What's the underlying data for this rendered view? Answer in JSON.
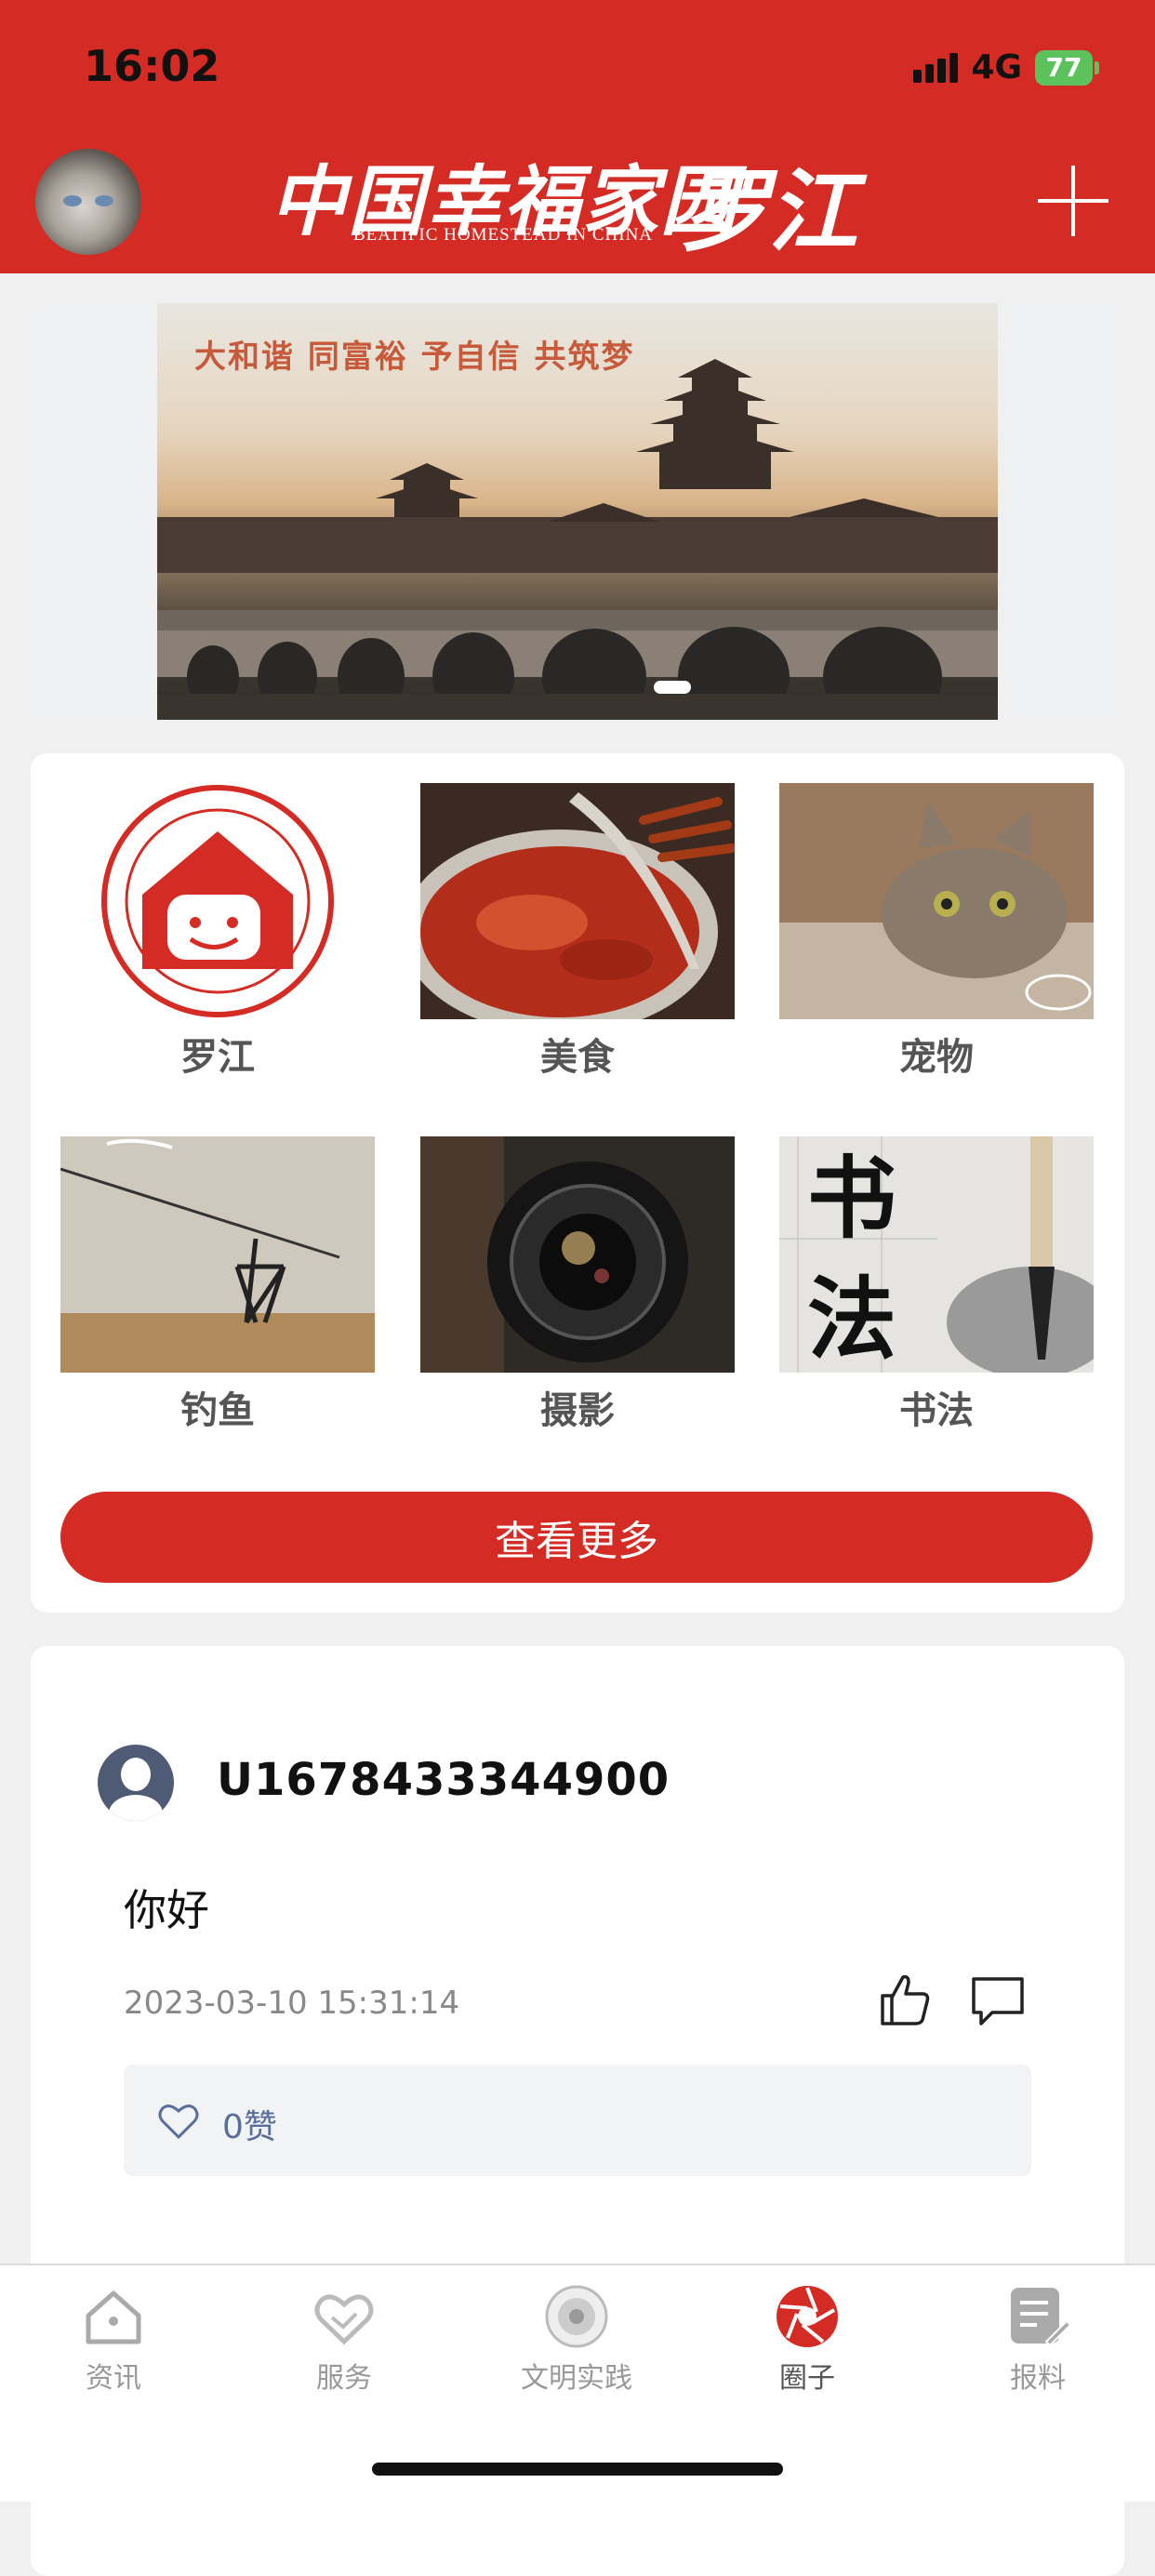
{
  "status_bar": {
    "time": "16:02",
    "network": "4G",
    "battery": "77"
  },
  "header": {
    "logo_cn": "中国幸福家园",
    "logo_en": "BEATIFIC HOMESTEAD IN CHINA",
    "logo_city": "罗江",
    "add_icon": "plus-icon"
  },
  "banner": {
    "slogan": "大和谐 同富裕 予自信 共筑梦",
    "active_index": 0,
    "total": 1
  },
  "categories": {
    "items": [
      {
        "label": "罗江"
      },
      {
        "label": "美食"
      },
      {
        "label": "宠物"
      },
      {
        "label": "钓鱼"
      },
      {
        "label": "摄影"
      },
      {
        "label": "书法"
      }
    ],
    "more_label": "查看更多"
  },
  "post": {
    "username": "U1678433344900",
    "content": "你好",
    "time": "2023-03-10 15:31:14",
    "likes_text": "0赞"
  },
  "tabbar": {
    "items": [
      {
        "label": "资讯",
        "icon": "home-icon"
      },
      {
        "label": "服务",
        "icon": "handshake-icon"
      },
      {
        "label": "文明实践",
        "icon": "emblem-icon"
      },
      {
        "label": "圈子",
        "icon": "aperture-icon"
      },
      {
        "label": "报料",
        "icon": "report-icon"
      }
    ],
    "active_index": 3
  },
  "colors": {
    "brand_red": "#d42b24",
    "link_blue": "#5a6e9c"
  }
}
